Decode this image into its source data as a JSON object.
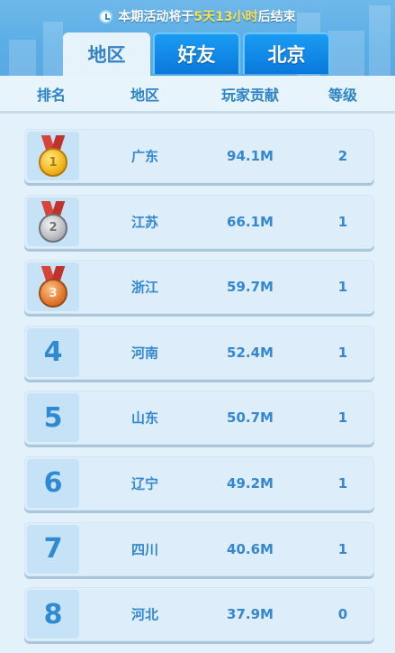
{
  "timer": {
    "prefix": "本期活动将于",
    "days": "5天",
    "hours": "13小时",
    "suffix": "后结束"
  },
  "tabs": [
    {
      "label": "地区",
      "active": true
    },
    {
      "label": "好友",
      "active": false
    },
    {
      "label": "北京",
      "active": false
    }
  ],
  "columns": {
    "rank": "排名",
    "region": "地区",
    "contribution": "玩家贡献",
    "level": "等级"
  },
  "rows": [
    {
      "rank": "1",
      "badge": "gold-medal-icon",
      "region": "广东",
      "contribution": "94.1M",
      "level": "2"
    },
    {
      "rank": "2",
      "badge": "silver-medal-icon",
      "region": "江苏",
      "contribution": "66.1M",
      "level": "1"
    },
    {
      "rank": "3",
      "badge": "bronze-medal-icon",
      "region": "浙江",
      "contribution": "59.7M",
      "level": "1"
    },
    {
      "rank": "4",
      "badge": "",
      "region": "河南",
      "contribution": "52.4M",
      "level": "1"
    },
    {
      "rank": "5",
      "badge": "",
      "region": "山东",
      "contribution": "50.7M",
      "level": "1"
    },
    {
      "rank": "6",
      "badge": "",
      "region": "辽宁",
      "contribution": "49.2M",
      "level": "1"
    },
    {
      "rank": "7",
      "badge": "",
      "region": "四川",
      "contribution": "40.6M",
      "level": "1"
    },
    {
      "rank": "8",
      "badge": "",
      "region": "河北",
      "contribution": "37.9M",
      "level": "0"
    }
  ],
  "colors": {
    "accent": "#2f8ad2",
    "highlight": "#ffe24a",
    "tab_active_bg": "#e7f3fb",
    "tab_inactive_bg": "#0a78dc"
  }
}
